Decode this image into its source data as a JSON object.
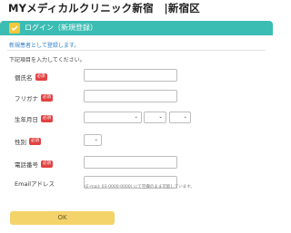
{
  "header": {
    "site_title": "MYメディカルクリニック新宿　|新宿区"
  },
  "panel": {
    "title": "ログイン（新規登録）",
    "subtitle": "新規患者として登録します。",
    "instruction": "下記項目を入力してください。",
    "required_label": "必須"
  },
  "form": {
    "name_label": "個氏名",
    "kana_label": "フリガナ",
    "birthdate_label": "生年月日",
    "gender_label": "性別",
    "phone_label": "電話番号",
    "email_label": "Emailアドレス",
    "email_hint": "(E-mail: 03-0000-0000) にて空欄のまま可能しています。"
  },
  "actions": {
    "ok_label": "OK"
  },
  "colors": {
    "header_bg": "#3bbdb3",
    "required_badge": "#e34141",
    "ok_button": "#f3d36a",
    "link_text": "#2f7fc9"
  }
}
